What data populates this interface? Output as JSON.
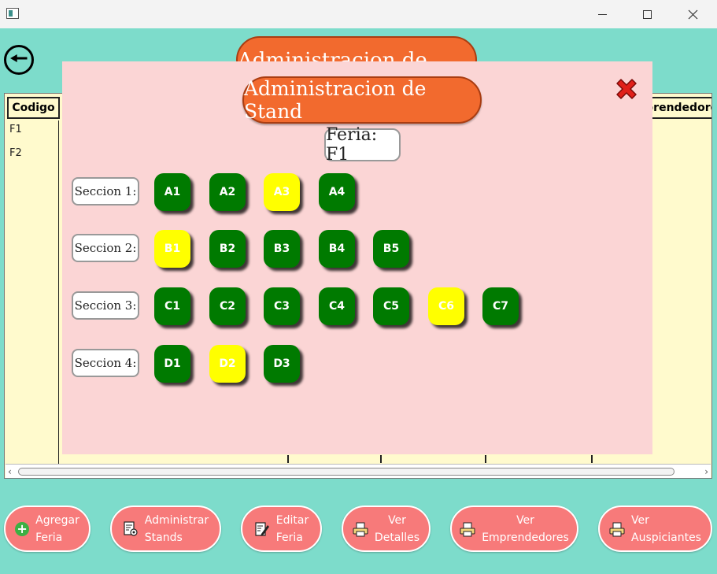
{
  "main": {
    "bg_title": "Administracion de Ferias",
    "table": {
      "columns": [
        "Codigo",
        "Emprendedores"
      ],
      "rows": [
        "F1",
        "F2"
      ]
    },
    "buttons": {
      "agregar": "Agregar\nFeria",
      "administrar": "Administrar\nStands",
      "editar": "Editar\nFeria",
      "detalles": "Ver\nDetalles",
      "emprendedores": "Ver\nEmprendedores",
      "auspiciantes": "Ver\nAuspiciantes"
    }
  },
  "modal": {
    "title": "Administracion de Stand",
    "feria": "Feria: F1",
    "sections": [
      {
        "label": "Seccion 1:",
        "stands": [
          {
            "code": "A1",
            "status": "free"
          },
          {
            "code": "A2",
            "status": "free"
          },
          {
            "code": "A3",
            "status": "taken"
          },
          {
            "code": "A4",
            "status": "free"
          }
        ]
      },
      {
        "label": "Seccion 2:",
        "stands": [
          {
            "code": "B1",
            "status": "taken"
          },
          {
            "code": "B2",
            "status": "free"
          },
          {
            "code": "B3",
            "status": "free"
          },
          {
            "code": "B4",
            "status": "free"
          },
          {
            "code": "B5",
            "status": "free"
          }
        ]
      },
      {
        "label": "Seccion 3:",
        "stands": [
          {
            "code": "C1",
            "status": "free"
          },
          {
            "code": "C2",
            "status": "free"
          },
          {
            "code": "C3",
            "status": "free"
          },
          {
            "code": "C4",
            "status": "free"
          },
          {
            "code": "C5",
            "status": "free"
          },
          {
            "code": "C6",
            "status": "taken"
          },
          {
            "code": "C7",
            "status": "free"
          }
        ]
      },
      {
        "label": "Seccion 4:",
        "stands": [
          {
            "code": "D1",
            "status": "free"
          },
          {
            "code": "D2",
            "status": "taken"
          },
          {
            "code": "D3",
            "status": "free"
          }
        ]
      }
    ]
  },
  "colors": {
    "background": "#7ddccb",
    "modal_bg": "#fbd5d5",
    "title_orange": "#f26a2e",
    "stand_free": "#007a00",
    "stand_taken": "#ffff00",
    "button_pink": "#f77a7a",
    "table_bg": "#fffacd"
  },
  "icons": {
    "back": "back-arrow-icon",
    "close": "close-x-icon",
    "agregar": "plus-circle-icon",
    "administrar": "gear-document-icon",
    "editar": "edit-document-icon",
    "ver": "printer-icon"
  }
}
